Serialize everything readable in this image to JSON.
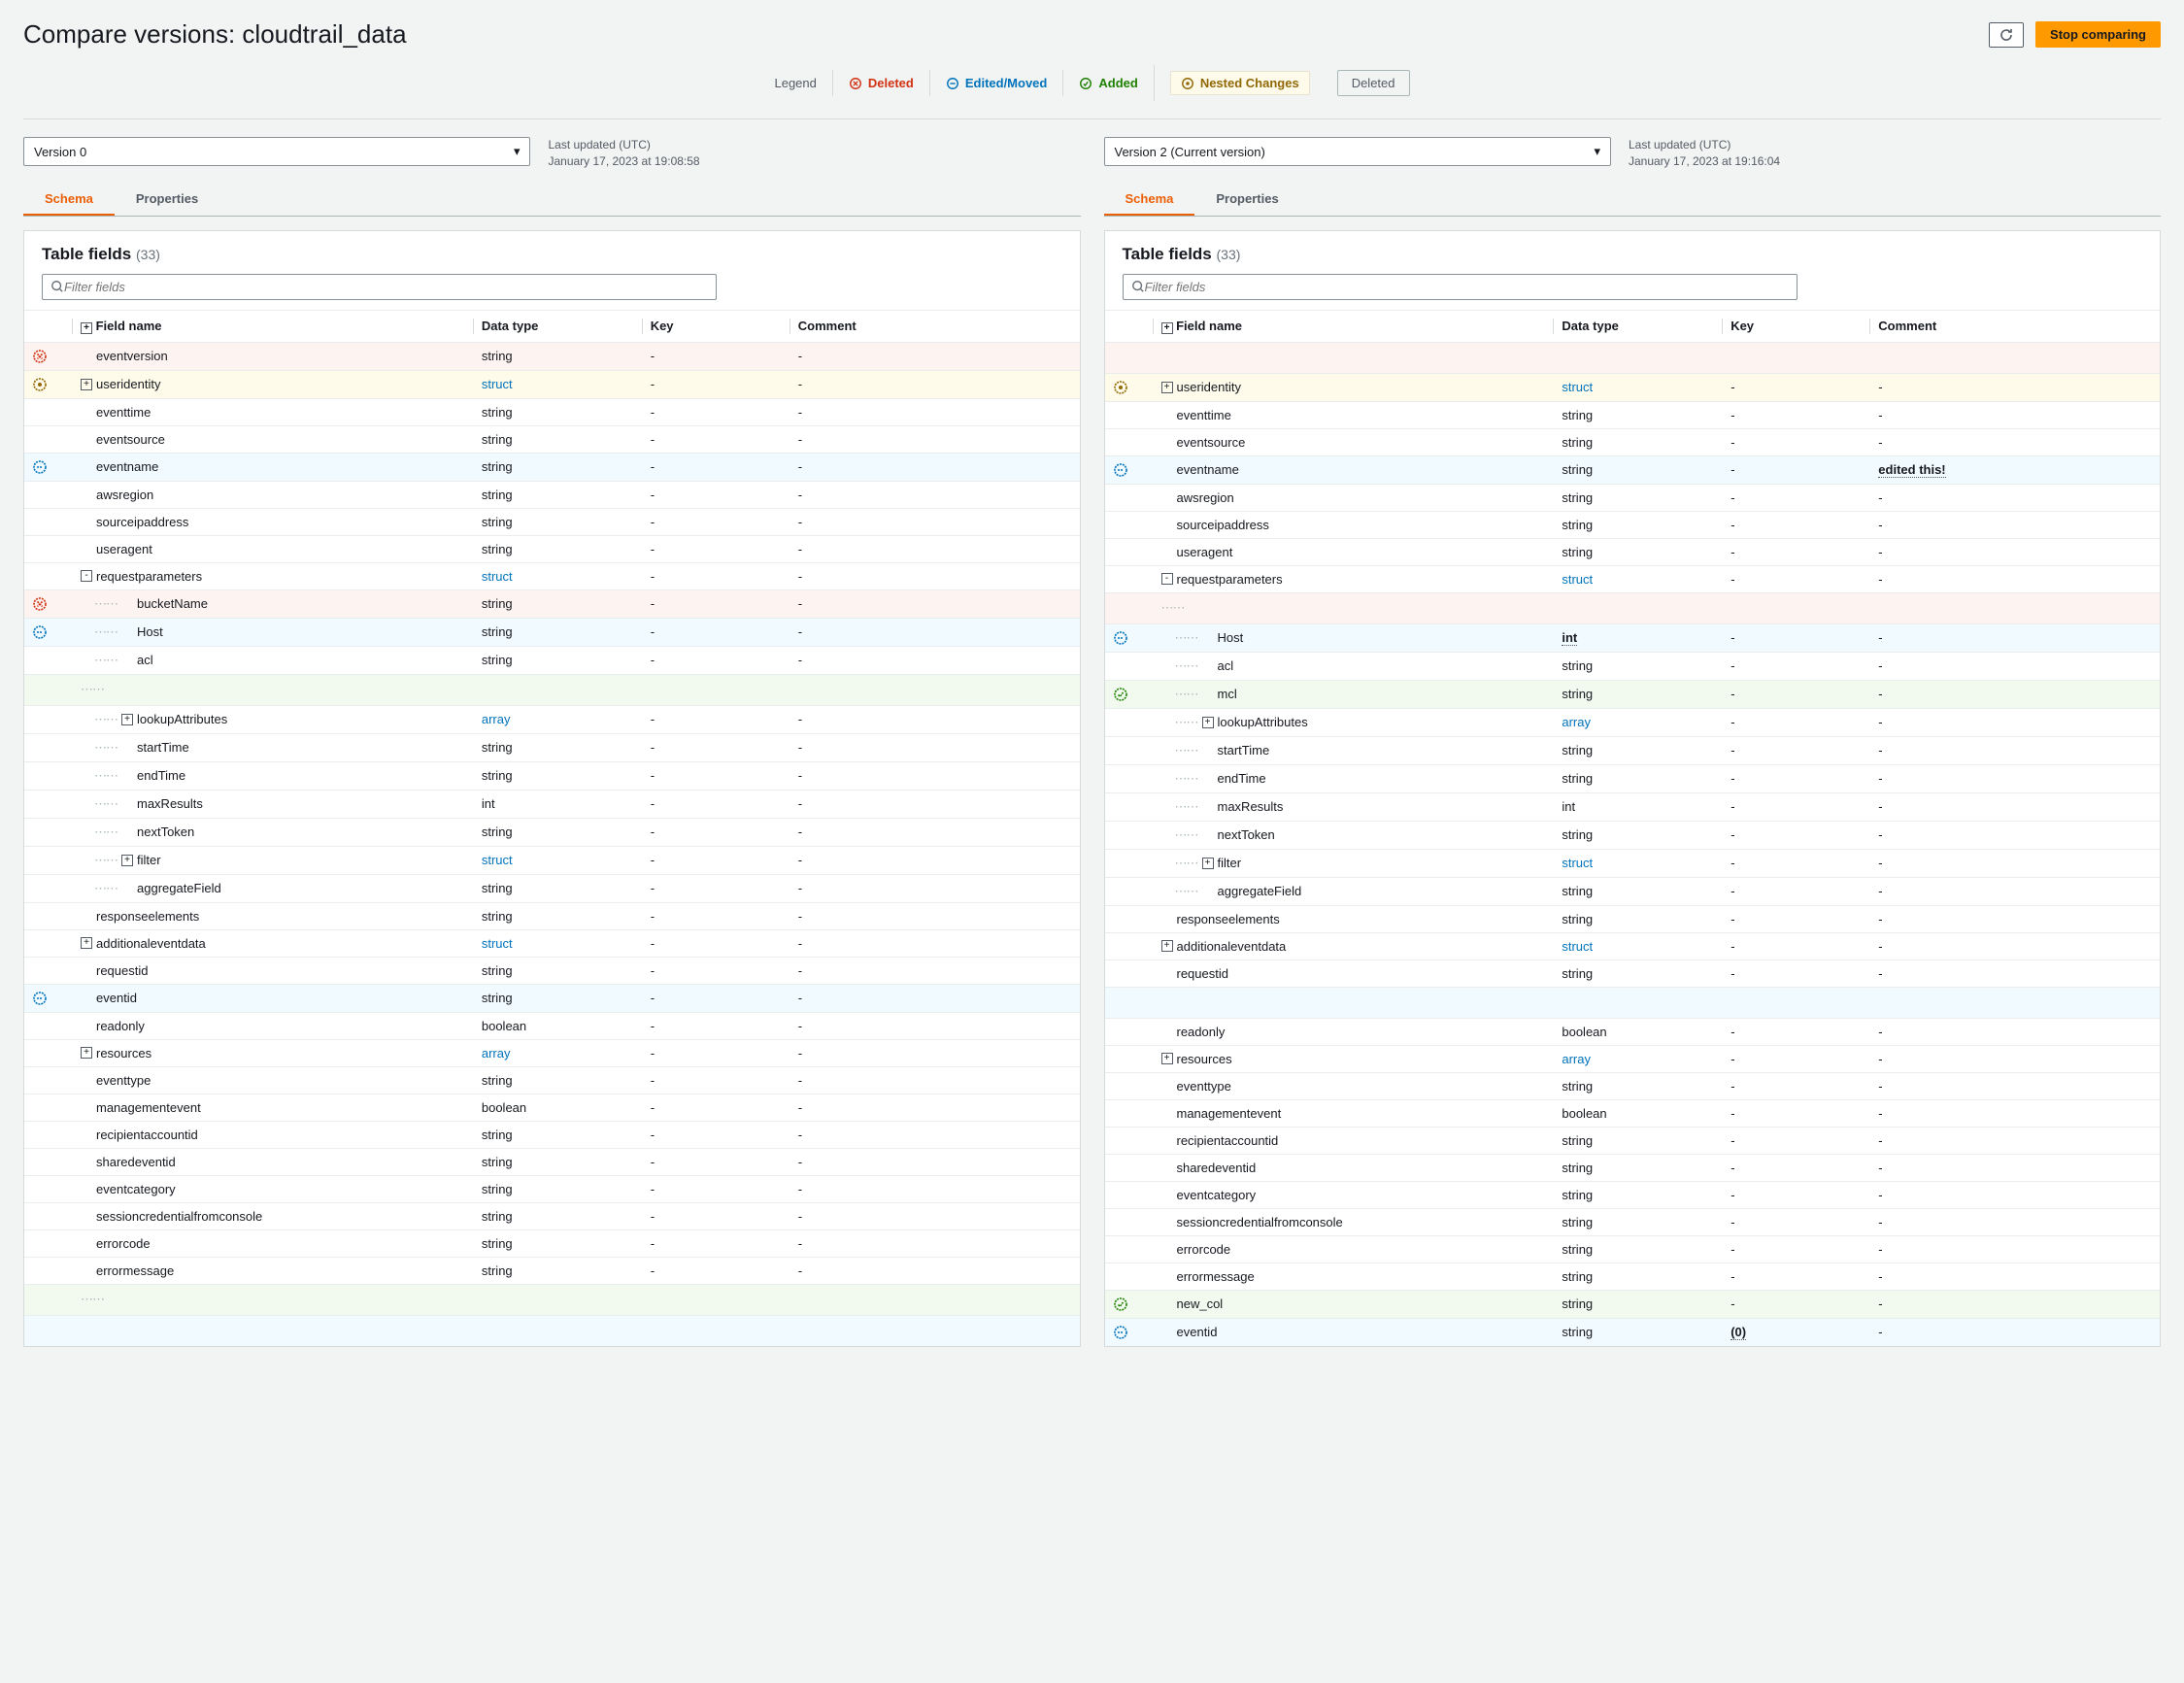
{
  "page_title": "Compare versions: cloudtrail_data",
  "buttons": {
    "stop": "Stop comparing"
  },
  "legend": {
    "label": "Legend",
    "deleted": "Deleted",
    "edited": "Edited/Moved",
    "added": "Added",
    "nested": "Nested Changes",
    "deleted_pill": "Deleted"
  },
  "left": {
    "version": "Version 0",
    "meta_label": "Last updated (UTC)",
    "meta_date": "January 17, 2023 at 19:08:58",
    "tabs": {
      "schema": "Schema",
      "properties": "Properties"
    },
    "panel_title": "Table fields",
    "panel_count": "(33)",
    "search_placeholder": "Filter fields",
    "th": {
      "name": "Field name",
      "type": "Data type",
      "key": "Key",
      "comment": "Comment"
    },
    "rows": [
      {
        "status": "deleted",
        "indent": 0,
        "exp": "",
        "name": "eventversion",
        "type": "string",
        "key": "-",
        "comment": "-"
      },
      {
        "status": "nested",
        "indent": 0,
        "exp": "+",
        "name": "useridentity",
        "type": "struct",
        "link": true,
        "key": "-",
        "comment": "-"
      },
      {
        "status": "",
        "indent": 0,
        "exp": "",
        "name": "eventtime",
        "type": "string",
        "key": "-",
        "comment": "-"
      },
      {
        "status": "",
        "indent": 0,
        "exp": "",
        "name": "eventsource",
        "type": "string",
        "key": "-",
        "comment": "-"
      },
      {
        "status": "edited",
        "indent": 0,
        "exp": "",
        "name": "eventname",
        "type": "string",
        "key": "-",
        "comment": "-"
      },
      {
        "status": "",
        "indent": 0,
        "exp": "",
        "name": "awsregion",
        "type": "string",
        "key": "-",
        "comment": "-"
      },
      {
        "status": "",
        "indent": 0,
        "exp": "",
        "name": "sourceipaddress",
        "type": "string",
        "key": "-",
        "comment": "-"
      },
      {
        "status": "",
        "indent": 0,
        "exp": "",
        "name": "useragent",
        "type": "string",
        "key": "-",
        "comment": "-"
      },
      {
        "status": "",
        "indent": 0,
        "exp": "-",
        "name": "requestparameters",
        "type": "struct",
        "link": true,
        "key": "-",
        "comment": "-"
      },
      {
        "status": "deleted",
        "indent": 1,
        "exp": "",
        "dots": true,
        "name": "bucketName",
        "type": "string",
        "key": "-",
        "comment": "-"
      },
      {
        "status": "edited",
        "indent": 1,
        "exp": "",
        "dots": true,
        "name": "Host",
        "type": "string",
        "key": "-",
        "comment": "-"
      },
      {
        "status": "",
        "indent": 1,
        "exp": "",
        "dots": true,
        "name": "acl",
        "type": "string",
        "key": "-",
        "comment": "-"
      },
      {
        "status": "empty-green"
      },
      {
        "status": "",
        "indent": 1,
        "exp": "+",
        "dots": true,
        "name": "lookupAttributes",
        "type": "array",
        "link": true,
        "key": "-",
        "comment": "-"
      },
      {
        "status": "",
        "indent": 1,
        "exp": "",
        "dots": true,
        "name": "startTime",
        "type": "string",
        "key": "-",
        "comment": "-"
      },
      {
        "status": "",
        "indent": 1,
        "exp": "",
        "dots": true,
        "name": "endTime",
        "type": "string",
        "key": "-",
        "comment": "-"
      },
      {
        "status": "",
        "indent": 1,
        "exp": "",
        "dots": true,
        "name": "maxResults",
        "type": "int",
        "key": "-",
        "comment": "-"
      },
      {
        "status": "",
        "indent": 1,
        "exp": "",
        "dots": true,
        "name": "nextToken",
        "type": "string",
        "key": "-",
        "comment": "-"
      },
      {
        "status": "",
        "indent": 1,
        "exp": "+",
        "dots": true,
        "name": "filter",
        "type": "struct",
        "link": true,
        "key": "-",
        "comment": "-"
      },
      {
        "status": "",
        "indent": 1,
        "exp": "",
        "dots": true,
        "name": "aggregateField",
        "type": "string",
        "key": "-",
        "comment": "-"
      },
      {
        "status": "",
        "indent": 0,
        "exp": "",
        "name": "responseelements",
        "type": "string",
        "key": "-",
        "comment": "-"
      },
      {
        "status": "",
        "indent": 0,
        "exp": "+",
        "name": "additionaleventdata",
        "type": "struct",
        "link": true,
        "key": "-",
        "comment": "-"
      },
      {
        "status": "",
        "indent": 0,
        "exp": "",
        "name": "requestid",
        "type": "string",
        "key": "-",
        "comment": "-"
      },
      {
        "status": "edited",
        "indent": 0,
        "exp": "",
        "name": "eventid",
        "type": "string",
        "key": "-",
        "comment": "-"
      },
      {
        "status": "",
        "indent": 0,
        "exp": "",
        "name": "readonly",
        "type": "boolean",
        "key": "-",
        "comment": "-"
      },
      {
        "status": "",
        "indent": 0,
        "exp": "+",
        "name": "resources",
        "type": "array",
        "link": true,
        "key": "-",
        "comment": "-"
      },
      {
        "status": "",
        "indent": 0,
        "exp": "",
        "name": "eventtype",
        "type": "string",
        "key": "-",
        "comment": "-"
      },
      {
        "status": "",
        "indent": 0,
        "exp": "",
        "name": "managementevent",
        "type": "boolean",
        "key": "-",
        "comment": "-"
      },
      {
        "status": "",
        "indent": 0,
        "exp": "",
        "name": "recipientaccountid",
        "type": "string",
        "key": "-",
        "comment": "-"
      },
      {
        "status": "",
        "indent": 0,
        "exp": "",
        "name": "sharedeventid",
        "type": "string",
        "key": "-",
        "comment": "-"
      },
      {
        "status": "",
        "indent": 0,
        "exp": "",
        "name": "eventcategory",
        "type": "string",
        "key": "-",
        "comment": "-"
      },
      {
        "status": "",
        "indent": 0,
        "exp": "",
        "name": "sessioncredentialfromconsole",
        "type": "string",
        "key": "-",
        "comment": "-"
      },
      {
        "status": "",
        "indent": 0,
        "exp": "",
        "name": "errorcode",
        "type": "string",
        "key": "-",
        "comment": "-"
      },
      {
        "status": "",
        "indent": 0,
        "exp": "",
        "name": "errormessage",
        "type": "string",
        "key": "-",
        "comment": "-"
      },
      {
        "status": "empty-green"
      },
      {
        "status": "empty-blue"
      }
    ]
  },
  "right": {
    "version": "Version 2 (Current version)",
    "meta_label": "Last updated (UTC)",
    "meta_date": "January 17, 2023 at 19:16:04",
    "tabs": {
      "schema": "Schema",
      "properties": "Properties"
    },
    "panel_title": "Table fields",
    "panel_count": "(33)",
    "search_placeholder": "Filter fields",
    "th": {
      "name": "Field name",
      "type": "Data type",
      "key": "Key",
      "comment": "Comment"
    },
    "rows": [
      {
        "status": "empty-deleted"
      },
      {
        "status": "nested",
        "indent": 0,
        "exp": "+",
        "name": "useridentity",
        "type": "struct",
        "link": true,
        "key": "-",
        "comment": "-"
      },
      {
        "status": "",
        "indent": 0,
        "exp": "",
        "name": "eventtime",
        "type": "string",
        "key": "-",
        "comment": "-"
      },
      {
        "status": "",
        "indent": 0,
        "exp": "",
        "name": "eventsource",
        "type": "string",
        "key": "-",
        "comment": "-"
      },
      {
        "status": "edited",
        "indent": 0,
        "exp": "",
        "name": "eventname",
        "type": "string",
        "key": "-",
        "comment": "edited this!",
        "comment_bold": true
      },
      {
        "status": "",
        "indent": 0,
        "exp": "",
        "name": "awsregion",
        "type": "string",
        "key": "-",
        "comment": "-"
      },
      {
        "status": "",
        "indent": 0,
        "exp": "",
        "name": "sourceipaddress",
        "type": "string",
        "key": "-",
        "comment": "-"
      },
      {
        "status": "",
        "indent": 0,
        "exp": "",
        "name": "useragent",
        "type": "string",
        "key": "-",
        "comment": "-"
      },
      {
        "status": "",
        "indent": 0,
        "exp": "-",
        "name": "requestparameters",
        "type": "struct",
        "link": true,
        "key": "-",
        "comment": "-"
      },
      {
        "status": "empty-deleted-child"
      },
      {
        "status": "edited",
        "indent": 1,
        "exp": "",
        "dots": true,
        "name": "Host",
        "type": "int",
        "type_bold": true,
        "key": "-",
        "comment": "-"
      },
      {
        "status": "",
        "indent": 1,
        "exp": "",
        "dots": true,
        "name": "acl",
        "type": "string",
        "key": "-",
        "comment": "-"
      },
      {
        "status": "added",
        "indent": 1,
        "exp": "",
        "dots": true,
        "name": "mcl",
        "type": "string",
        "key": "-",
        "comment": "-"
      },
      {
        "status": "",
        "indent": 1,
        "exp": "+",
        "dots": true,
        "name": "lookupAttributes",
        "type": "array",
        "link": true,
        "key": "-",
        "comment": "-"
      },
      {
        "status": "",
        "indent": 1,
        "exp": "",
        "dots": true,
        "name": "startTime",
        "type": "string",
        "key": "-",
        "comment": "-"
      },
      {
        "status": "",
        "indent": 1,
        "exp": "",
        "dots": true,
        "name": "endTime",
        "type": "string",
        "key": "-",
        "comment": "-"
      },
      {
        "status": "",
        "indent": 1,
        "exp": "",
        "dots": true,
        "name": "maxResults",
        "type": "int",
        "key": "-",
        "comment": "-"
      },
      {
        "status": "",
        "indent": 1,
        "exp": "",
        "dots": true,
        "name": "nextToken",
        "type": "string",
        "key": "-",
        "comment": "-"
      },
      {
        "status": "",
        "indent": 1,
        "exp": "+",
        "dots": true,
        "name": "filter",
        "type": "struct",
        "link": true,
        "key": "-",
        "comment": "-"
      },
      {
        "status": "",
        "indent": 1,
        "exp": "",
        "dots": true,
        "name": "aggregateField",
        "type": "string",
        "key": "-",
        "comment": "-"
      },
      {
        "status": "",
        "indent": 0,
        "exp": "",
        "name": "responseelements",
        "type": "string",
        "key": "-",
        "comment": "-"
      },
      {
        "status": "",
        "indent": 0,
        "exp": "+",
        "name": "additionaleventdata",
        "type": "struct",
        "link": true,
        "key": "-",
        "comment": "-"
      },
      {
        "status": "",
        "indent": 0,
        "exp": "",
        "name": "requestid",
        "type": "string",
        "key": "-",
        "comment": "-"
      },
      {
        "status": "empty-blue"
      },
      {
        "status": "",
        "indent": 0,
        "exp": "",
        "name": "readonly",
        "type": "boolean",
        "key": "-",
        "comment": "-"
      },
      {
        "status": "",
        "indent": 0,
        "exp": "+",
        "name": "resources",
        "type": "array",
        "link": true,
        "key": "-",
        "comment": "-"
      },
      {
        "status": "",
        "indent": 0,
        "exp": "",
        "name": "eventtype",
        "type": "string",
        "key": "-",
        "comment": "-"
      },
      {
        "status": "",
        "indent": 0,
        "exp": "",
        "name": "managementevent",
        "type": "boolean",
        "key": "-",
        "comment": "-"
      },
      {
        "status": "",
        "indent": 0,
        "exp": "",
        "name": "recipientaccountid",
        "type": "string",
        "key": "-",
        "comment": "-"
      },
      {
        "status": "",
        "indent": 0,
        "exp": "",
        "name": "sharedeventid",
        "type": "string",
        "key": "-",
        "comment": "-"
      },
      {
        "status": "",
        "indent": 0,
        "exp": "",
        "name": "eventcategory",
        "type": "string",
        "key": "-",
        "comment": "-"
      },
      {
        "status": "",
        "indent": 0,
        "exp": "",
        "name": "sessioncredentialfromconsole",
        "type": "string",
        "key": "-",
        "comment": "-"
      },
      {
        "status": "",
        "indent": 0,
        "exp": "",
        "name": "errorcode",
        "type": "string",
        "key": "-",
        "comment": "-"
      },
      {
        "status": "",
        "indent": 0,
        "exp": "",
        "name": "errormessage",
        "type": "string",
        "key": "-",
        "comment": "-"
      },
      {
        "status": "added",
        "indent": 0,
        "exp": "",
        "name": "new_col",
        "type": "string",
        "key": "-",
        "comment": "-"
      },
      {
        "status": "edited",
        "indent": 0,
        "exp": "",
        "name": "eventid",
        "type": "string",
        "key": "(0)",
        "key_bold": true,
        "comment": "-"
      }
    ]
  }
}
